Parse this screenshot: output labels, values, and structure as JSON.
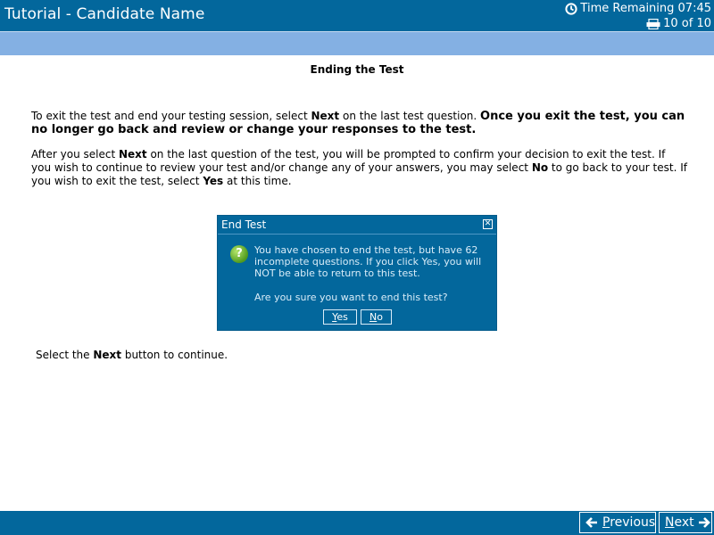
{
  "header": {
    "title": "Tutorial - Candidate Name",
    "time_remaining": "Time Remaining 07:45",
    "progress": "10 of 10"
  },
  "main": {
    "title": "Ending the Test",
    "para1": {
      "a": "To exit the test and end your testing session, select ",
      "b": "Next",
      "c": " on the last test question.  ",
      "d": "Once you exit the test, you can no longer go back and review or change your responses to the test."
    },
    "para2": {
      "a": "After you select ",
      "b": "Next",
      "c": " on the last question of the test, you will be prompted to confirm your decision to exit the test.  If you wish to continue to review your test and/or change any of your answers, you may select ",
      "d": "No",
      "e": " to go back to your test.  If you wish to exit the test, select ",
      "f": "Yes",
      "g": " at this time."
    },
    "instruction": {
      "a": "Select the ",
      "b": "Next",
      "c": " button to continue."
    }
  },
  "dialog": {
    "title": "End Test",
    "message": "You have chosen to end the test, but have 62 incomplete questions.  If you click Yes, you will NOT be able to return to this test.",
    "question": "Are you sure you want to end this test?",
    "yes_first": "Y",
    "yes_rest": "es",
    "no_first": "N",
    "no_rest": "o"
  },
  "footer": {
    "previous_first": "P",
    "previous_rest": "revious",
    "next_first": "N",
    "next_rest": "ext"
  },
  "colors": {
    "bar": "#03679c",
    "strip": "#84b0e3"
  }
}
